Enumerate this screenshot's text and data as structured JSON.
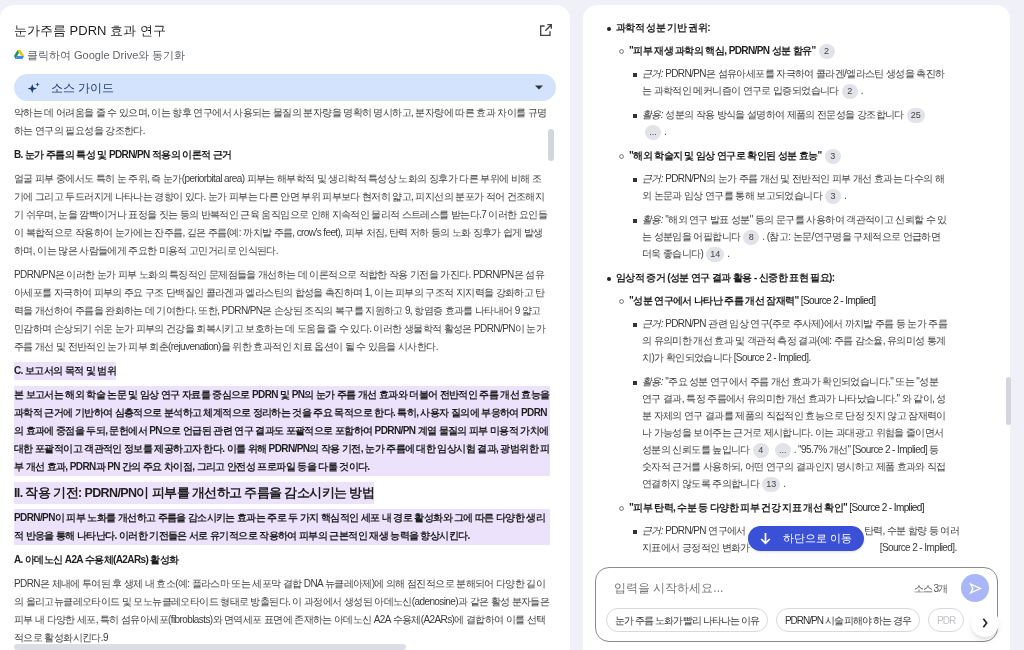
{
  "source": {
    "title": "눈가주름 PDRN 효과 연구",
    "sync_label": "클릭하여 Google Drive와 동기화",
    "guide_label": "소스 가이드",
    "blocks": [
      {
        "kind": "paragraph",
        "highlighted": false,
        "text": "악하는 데 어려움을 줄 수 있으며, 이는 향후 연구에서 사용되는 물질의 분자량을 명확히 명시하고, 분자량에 따른 효과 차이를 규명하는 연구의 필요성을 강조한다."
      },
      {
        "kind": "heading",
        "highlighted": false,
        "text": "B. 눈가 주름의 특성 및 PDRN/PN 적용의 이론적 근거"
      },
      {
        "kind": "paragraph",
        "highlighted": false,
        "text": "얼굴 피부 중에서도 특히 눈 주위, 즉 눈가(periorbital area) 피부는 해부학적 및 생리학적 특성상 노화의 징후가 다른 부위에 비해 조기에 그리고 두드러지게 나타나는 경향이 있다. 눈가 피부는 다른 안면 부위 피부보다 현저히 얇고, 피지선의 분포가 적어 건조해지기 쉬우며, 눈을 깜빡이거나 표정을 짓는 등의 반복적인 근육 움직임으로 인해 지속적인 물리적 스트레스를 받는다.7 이러한 요인들이 복합적으로 작용하여 눈가에는 잔주름, 깊은 주름(예: 까치발 주름, crow's feet), 피부 처짐, 탄력 저하 등의 노화 징후가 쉽게 발생하며, 이는 많은 사람들에게 주요한 미용적 고민거리로 인식된다."
      },
      {
        "kind": "paragraph",
        "highlighted": false,
        "text": "PDRN/PN은 이러한 눈가 피부 노화의 특징적인 문제점들을 개선하는 데 이론적으로 적합한 작용 기전을 가진다. PDRN/PN은 섬유아세포를 자극하여 피부의 주요 구조 단백질인 콜라겐과 엘라스틴의 합성을 촉진하며 1, 이는 피부의 구조적 지지력을 강화하고 탄력을 개선하여 주름을 완화하는 데 기여한다. 또한, PDRN/PN은 손상된 조직의 복구를 지원하고 9, 항염증 효과를 나타내어 9 얇고 민감하며 손상되기 쉬운 눈가 피부의 건강을 회복시키고 보호하는 데 도움을 줄 수 있다. 이러한 생물학적 활성은 PDRN/PN이 눈가 주름 개선 및 전반적인 눈가 피부 회춘(rejuvenation)을 위한 효과적인 치료 옵션이 될 수 있음을 시사한다."
      },
      {
        "kind": "heading",
        "highlighted": true,
        "text": "C. 보고서의 목적 및 범위"
      },
      {
        "kind": "bold_paragraph",
        "highlighted": true,
        "text": "본 보고서는 해외 학술 논문 및 임상 연구 자료를 중심으로 PDRN 및 PN의 눈가 주름 개선 효과와 더불어 전반적인 주름 개선 효능을 과학적 근거에 기반하여 심층적으로 분석하고 체계적으로 정리하는 것을 주요 목적으로 한다. 특히, 사용자 질의에 부응하여 PDRN의 효과에 중점을 두되, 문헌에서 PN으로 언급된 관련 연구 결과도 포괄적으로 포함하여 PDRN/PN 계열 물질의 피부 미용적 가치에 대한 포괄적이고 객관적인 정보를 제공하고자 한다. 이를 위해 PDRN/PN의 작용 기전, 눈가 주름에 대한 임상시험 결과, 광범위한 피부 개선 효과, PDRN과 PN 간의 주요 차이점, 그리고 안전성 프로파일 등을 다룰 것이다."
      },
      {
        "kind": "section",
        "highlighted": true,
        "text": "II. 작용 기전: PDRN/PN이 피부를 개선하고 주름을 감소시키는 방법"
      },
      {
        "kind": "bold_paragraph",
        "highlighted": true,
        "text": "PDRN/PN이 피부 노화를 개선하고 주름을 감소시키는 효과는 주로 두 가지 핵심적인 세포 내 경로 활성화와 그에 따른 다양한 생리적 반응을 통해 나타난다. 이러한 기전들은 서로 유기적으로 작용하여 피부의 근본적인 재생 능력을 향상시킨다."
      },
      {
        "kind": "heading",
        "highlighted": false,
        "text": "A. 아데노신 A2A 수용체(A2ARs) 활성화"
      },
      {
        "kind": "paragraph",
        "highlighted": false,
        "text": "PDRN은 체내에 투여된 후 생체 내 효소(예: 플라스마 또는 세포막 결합 DNA 뉴클레아제)에 의해 점진적으로 분해되어 다양한 길이의 올리고뉴클레오타이드 및 모노뉴클레오타이드 형태로 방출된다. 이 과정에서 생성된 아데노신(adenosine)과 같은 활성 분자들은 피부 내 다양한 세포, 특히 섬유아세포(fibroblasts)와 면역세포 표면에 존재하는 아데노신 A2A 수용체(A2ARs)에 결합하여 이를 선택적으로 활성화시킨다.9"
      }
    ]
  },
  "chat": {
    "items": [
      {
        "parts": [
          {
            "kind": "text",
            "text": "과학적 성분 기반 권위:"
          }
        ],
        "children": [
          {
            "parts": [
              {
                "kind": "text",
                "text": "**\"피부 재생 과학의 핵심, PDRN/PN 성분 함유\"**"
              },
              {
                "kind": "chip",
                "text": "2"
              }
            ],
            "children": [
              {
                "parts": [
                  {
                    "kind": "text",
                    "text": "*근거:* PDRN/PN은 섬유아세포를 자극하여 콜라겐/엘라스틴 생성을 촉진하는 과학적인 메커니즘이 연구로 입증되었습니다"
                  },
                  {
                    "kind": "chip",
                    "text": "2"
                  },
                  {
                    "kind": "text",
                    "text": "."
                  }
                ]
              },
              {
                "parts": [
                  {
                    "kind": "text",
                    "text": "*활용:* 성분의 작용 방식을 설명하여 제품의 전문성을 강조합니다"
                  },
                  {
                    "kind": "chip",
                    "text": "25"
                  },
                  {
                    "kind": "chip",
                    "text": "..."
                  },
                  {
                    "kind": "text",
                    "text": "."
                  }
                ]
              }
            ]
          },
          {
            "parts": [
              {
                "kind": "text",
                "text": "**\"해외 학술지 및 임상 연구로 확인된 성분 효능\"**"
              },
              {
                "kind": "chip",
                "text": "3"
              }
            ],
            "children": [
              {
                "parts": [
                  {
                    "kind": "text",
                    "text": "*근거:* PDRN/PN의 눈가 주름 개선 및 전반적인 피부 개선 효과는 다수의 해외 논문과 임상 연구를 통해 보고되었습니다"
                  },
                  {
                    "kind": "chip",
                    "text": "3"
                  },
                  {
                    "kind": "text",
                    "text": "."
                  }
                ]
              },
              {
                "parts": [
                  {
                    "kind": "text",
                    "text": "*활용:* \"해외 연구 발표 성분\" 등의 문구를 사용하여 객관적이고 신뢰할 수 있는 성분임을 어필합니다"
                  },
                  {
                    "kind": "chip",
                    "text": "8"
                  },
                  {
                    "kind": "text",
                    "text": ". (참고: 논문/연구명을 구체적으로 언급하면 더욱 좋습니다)"
                  },
                  {
                    "kind": "chip",
                    "text": "14"
                  },
                  {
                    "kind": "text",
                    "text": "."
                  }
                ]
              }
            ]
          }
        ]
      },
      {
        "parts": [
          {
            "kind": "text",
            "text": "임상적 증거 (성분 연구 결과 활용 - 신중한 표현 필요):"
          }
        ],
        "children": [
          {
            "parts": [
              {
                "kind": "text",
                "text": "**\"성분 연구에서 나타난 주름 개선 잠재력\"** [Source 2 - Implied]"
              }
            ],
            "children": [
              {
                "parts": [
                  {
                    "kind": "text",
                    "text": "*근거:* PDRN/PN 관련 임상 연구(주로 주사제)에서 까치발 주름 등 눈가 주름의 유의미한 개선 효과 및 객관적 측정 결과(예: 주름 감소율, 유의미성 통계치)가 확인되었습니다 [Source 2 - Implied]."
                  }
                ]
              },
              {
                "parts": [
                  {
                    "kind": "text",
                    "text": "*활용:* \"주요 성분 연구에서 주름 개선 효과가 확인되었습니다.\" 또는 \"성분 연구 결과, 특정 주름에서 유의미한 개선 효과가 나타났습니다.\" 와 같이, 성분 자체의 연구 결과를 제품의 직접적인 효능으로 단정 짓지 않고 잠재력이나 가능성을 보여주는 근거로 제시합니다. 이는 과대광고 위험을 줄이면서 성분의 신뢰도를 높입니다"
                  },
                  {
                    "kind": "chip",
                    "text": "4"
                  },
                  {
                    "kind": "chip",
                    "text": "..."
                  },
                  {
                    "kind": "text",
                    "text": ". \"95.7% 개선\" [Source 2 - Implied] 등 숫자적 근거를 사용하되, 어떤 연구의 결과인지 명시하고 제품 효과와 직접 연결하지 않도록 주의합니다"
                  },
                  {
                    "kind": "chip",
                    "text": "13"
                  },
                  {
                    "kind": "text",
                    "text": "."
                  }
                ]
              }
            ]
          },
          {
            "parts": [
              {
                "kind": "text",
                "text": "**\"피부 탄력, 수분 등 다양한 피부 건강 지표 개선 확인\"** [Source 2 - Implied]"
              }
            ],
            "children": [
              {
                "parts": [
                  {
                    "kind": "text",
                    "text": "*근거:* PDRN/PN 연구에서"
                  },
                  {
                    "kind": "covered"
                  },
                  {
                    "kind": "text",
                    "text": "탄력, 수분 함량 등 여러"
                  },
                  {
                    "kind": "break"
                  },
                  {
                    "kind": "text",
                    "text": "지표에서 긍정적인 변화가"
                  },
                  {
                    "kind": "covered"
                  },
                  {
                    "kind": "text",
                    "text": "[Source 2 - Implied]."
                  }
                ]
              }
            ]
          }
        ]
      }
    ],
    "jump_button": "하단으로 이동",
    "input": {
      "placeholder": "입력을 시작하세요...",
      "source_count": "소스 3개"
    },
    "suggestions": [
      "눈가 주름 노화가 빨리 나타나는 이유",
      "PDRN/PN 시술 피해야 하는 경우",
      "PDR"
    ]
  }
}
